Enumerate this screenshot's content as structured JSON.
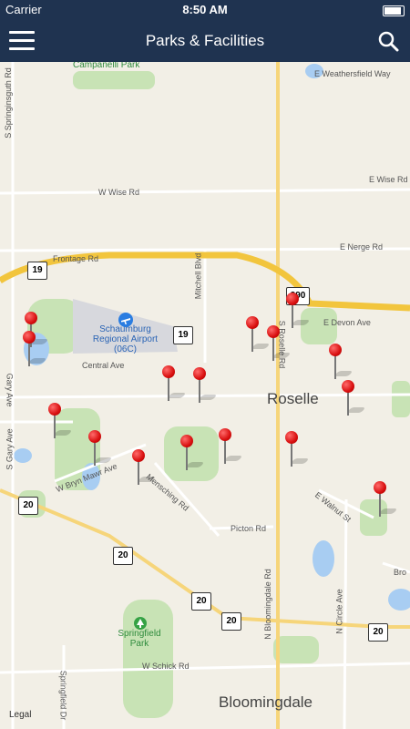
{
  "status": {
    "carrier": "Carrier",
    "time": "8:50 AM"
  },
  "header": {
    "title": "Parks & Facilities"
  },
  "map": {
    "towns": {
      "roselle": "Roselle",
      "bloomingdale": "Bloomingdale"
    },
    "airport": "Schaumburg Regional Airport (06C)",
    "park": "Springfield Park",
    "legal": "Legal",
    "roads": {
      "campanelli": "Campanelli Park",
      "weathersfield": "E Weathersfield Way",
      "springinsguth": "S Springinsguth Rd",
      "wise_w": "W Wise Rd",
      "wise_e": "E Wise Rd",
      "nerge": "E Nerge Rd",
      "frontage": "Frontage Rd",
      "mitchell": "Mitchell Blvd",
      "devon": "E Devon Ave",
      "roselle_rd": "S Roselle Rd",
      "central": "Central Ave",
      "gary": "Gary Ave",
      "sgary": "S Gary Ave",
      "brynmawr": "W Bryn Mawr Ave",
      "mensching": "Mensching Rd",
      "picton": "Picton Rd",
      "walnut": "E Walnut St",
      "nbloomingdale": "N Bloomingdale Rd",
      "ncircle": "N Circle Ave",
      "schick": "W Schick Rd",
      "springfield": "Springfield Dr",
      "bro": "Bro"
    },
    "shields": {
      "r19a": "19",
      "r19b": "19",
      "r20a": "20",
      "r20b": "20",
      "r20c": "20",
      "r20d": "20",
      "r20e": "20",
      "r390": "390"
    }
  }
}
